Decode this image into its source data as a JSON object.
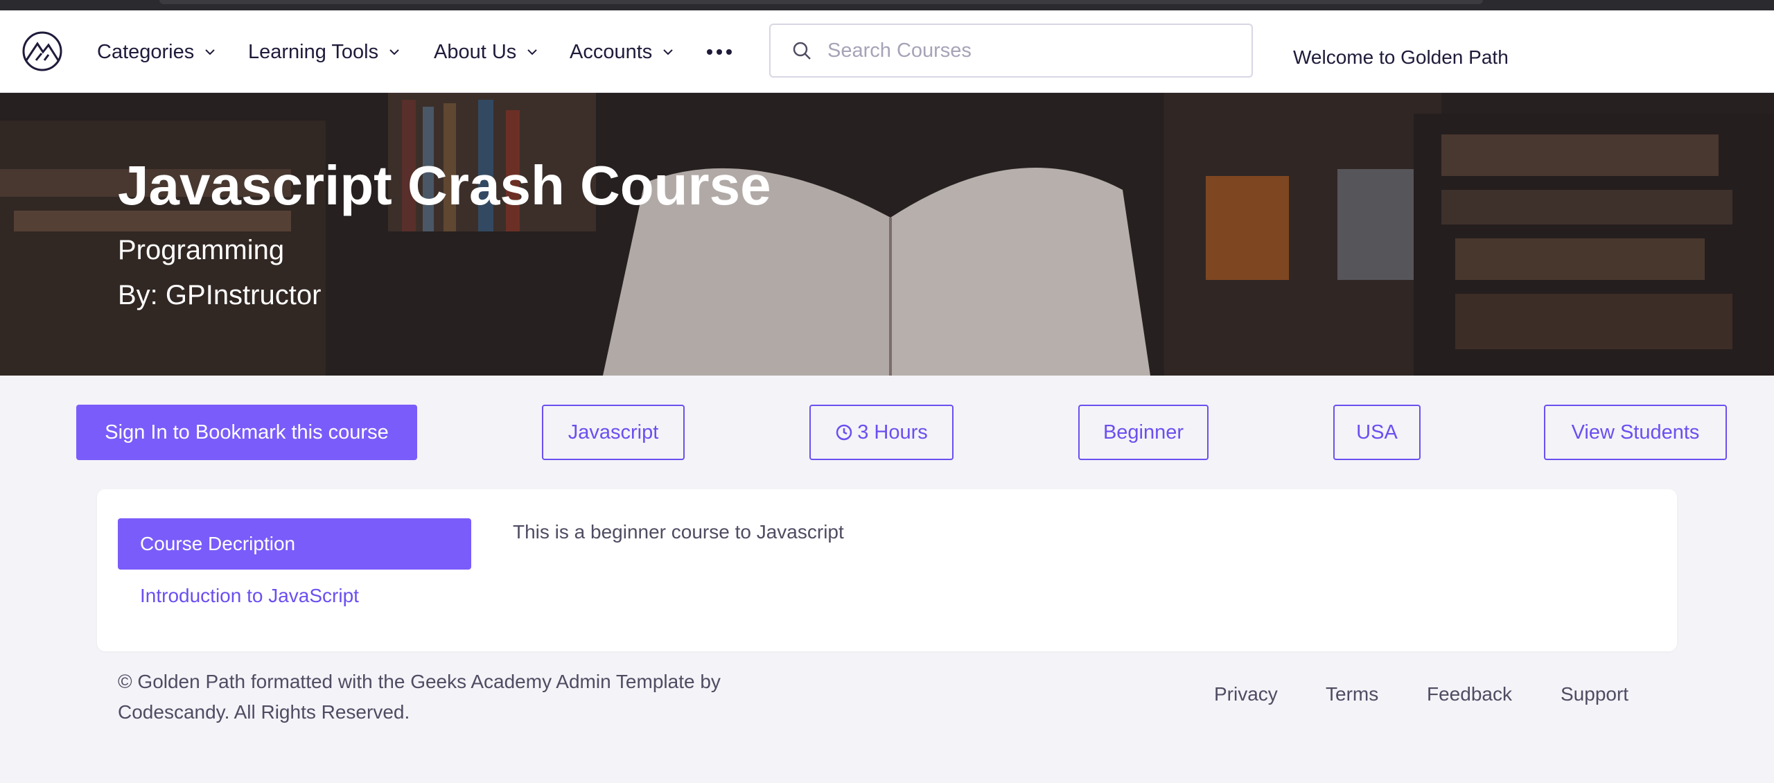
{
  "nav": {
    "items": [
      {
        "label": "Categories"
      },
      {
        "label": "Learning Tools"
      },
      {
        "label": "About Us"
      },
      {
        "label": "Accounts"
      }
    ],
    "search_placeholder": "Search Courses",
    "welcome": "Welcome to Golden Path"
  },
  "hero": {
    "title": "Javascript Crash Course",
    "category": "Programming",
    "instructor": "By: GPInstructor"
  },
  "actions": {
    "bookmark": "Sign In to Bookmark this course",
    "language": "Javascript",
    "duration": "3 Hours",
    "level": "Beginner",
    "country": "USA",
    "view_students": "View Students"
  },
  "course": {
    "tab_description": "Course Decription",
    "tab_lesson": "Introduction to JavaScript",
    "description": "This is a beginner course to Javascript"
  },
  "footer": {
    "copyright": "© Golden Path formatted with the Geeks Academy Admin Template by Codescandy. All Rights Reserved.",
    "links": [
      "Privacy",
      "Terms",
      "Feedback",
      "Support"
    ]
  },
  "colors": {
    "accent": "#7a5cfa",
    "accent_text": "#6b4ff0",
    "background": "#f4f3f8"
  }
}
